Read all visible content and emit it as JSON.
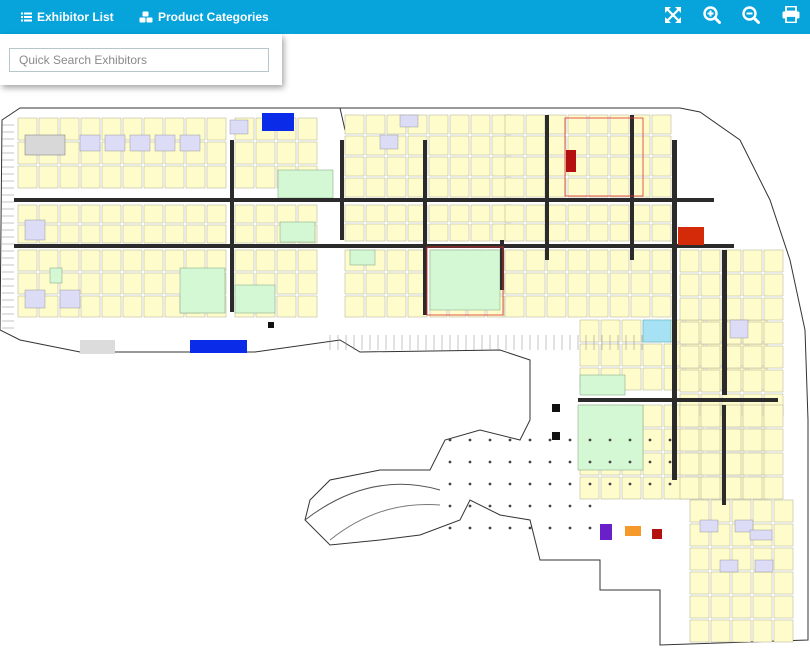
{
  "toolbar": {
    "exhibitor_list_label": "Exhibitor List",
    "exhibitor_list_icon": "list-icon",
    "product_categories_label": "Product Categories",
    "product_categories_icon": "cubes-icon",
    "tools": [
      "fullscreen-icon",
      "zoom-in-icon",
      "zoom-out-icon",
      "print-icon"
    ]
  },
  "search": {
    "placeholder": "Quick Search Exhibitors",
    "value": ""
  },
  "map": {
    "booth_colors": {
      "standard": "#fffccc",
      "large_island": "#d4f8d4",
      "featured_purple": "#dcdcf6",
      "highlight_blue": "#0a2be8",
      "highlight_red": "#d42a0a",
      "dark_red": "#b41010",
      "pavilion_orange": "#f59a2a",
      "pavilion_violet": "#6a20c8",
      "cyan": "#a6e2f4",
      "aisle": "#2b2b2b"
    }
  },
  "colors": {
    "topbar": "#07a4dc",
    "topbar_text": "#ffffff"
  }
}
